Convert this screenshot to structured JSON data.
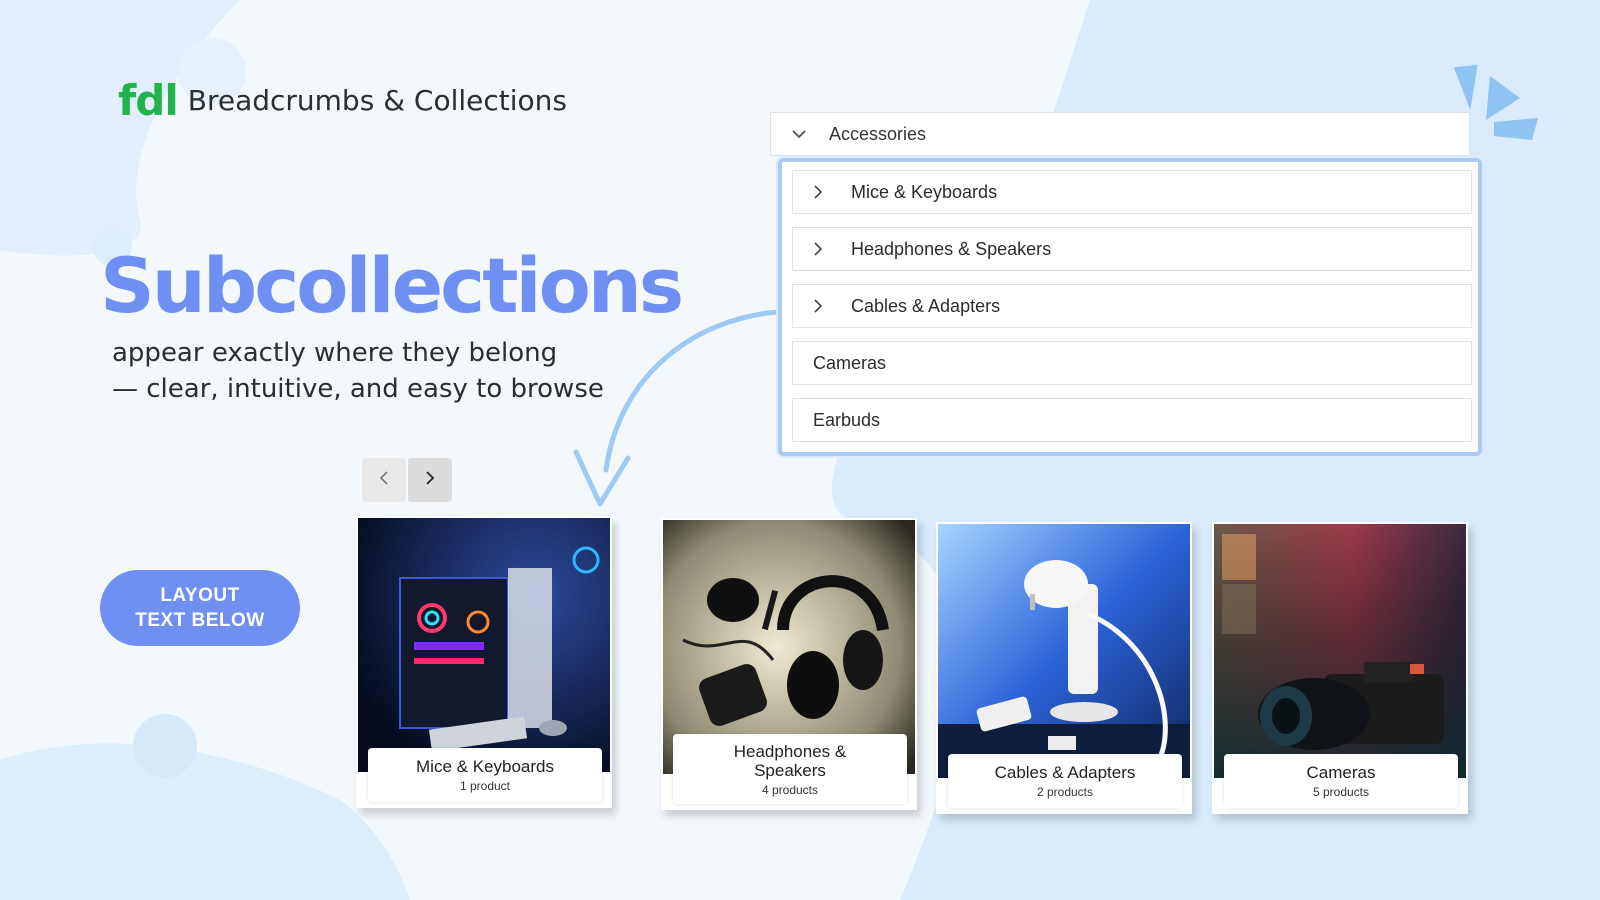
{
  "brand": {
    "logo_mark": "fdl",
    "app_title": "Breadcrumbs & Collections"
  },
  "hero": {
    "headline": "Subcollections",
    "subtitle_line1": "appear exactly where they belong",
    "subtitle_line2": "— clear, intuitive, and easy to browse"
  },
  "layout_badge": {
    "line1": "LAYOUT",
    "line2": "TEXT BELOW"
  },
  "collection_tree": {
    "parent": {
      "label": "Accessories",
      "icon": "chevron-down-icon",
      "expanded": true
    },
    "children": [
      {
        "label": "Mice & Keyboards",
        "icon": "chevron-right-icon",
        "has_children": true
      },
      {
        "label": "Headphones & Speakers",
        "icon": "chevron-right-icon",
        "has_children": true
      },
      {
        "label": "Cables & Adapters",
        "icon": "chevron-right-icon",
        "has_children": true
      },
      {
        "label": "Cameras",
        "has_children": false
      },
      {
        "label": "Earbuds",
        "has_children": false
      }
    ]
  },
  "carousel": {
    "prev_icon": "chevron-left-icon",
    "next_icon": "chevron-right-icon",
    "cards": [
      {
        "title": "Mice & Keyboards",
        "count": "1 product"
      },
      {
        "title": "Headphones &",
        "title_line2": "Speakers",
        "count": "4 products"
      },
      {
        "title": "Cables & Adapters",
        "count": "2 products"
      },
      {
        "title": "Cameras",
        "count": "5 products"
      }
    ]
  },
  "colors": {
    "accent": "#6f8ff2",
    "brand_green": "#21b24b",
    "highlight_border": "#a9cbf5",
    "background_blob": "#dcecfb"
  }
}
